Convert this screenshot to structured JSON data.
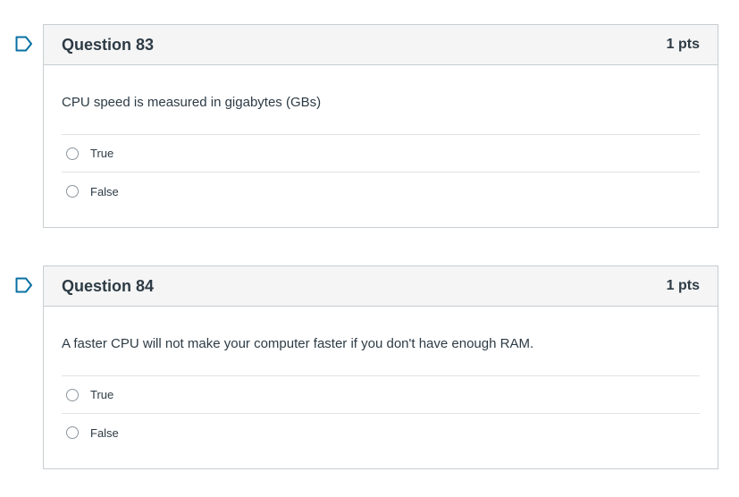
{
  "questions": [
    {
      "title": "Question 83",
      "points": "1 pts",
      "text": "CPU speed is measured in gigabytes (GBs)",
      "answers": [
        {
          "label": "True"
        },
        {
          "label": "False"
        }
      ]
    },
    {
      "title": "Question 84",
      "points": "1 pts",
      "text": "A faster CPU will not make your computer faster if you don't have enough RAM.",
      "answers": [
        {
          "label": "True"
        },
        {
          "label": "False"
        }
      ]
    }
  ],
  "icons": {
    "flag": "bookmark-flag-icon"
  },
  "colors": {
    "flag": "#0770a3",
    "border": "#c7cdd1",
    "header_bg": "#f5f5f5",
    "text": "#2d3b45"
  }
}
